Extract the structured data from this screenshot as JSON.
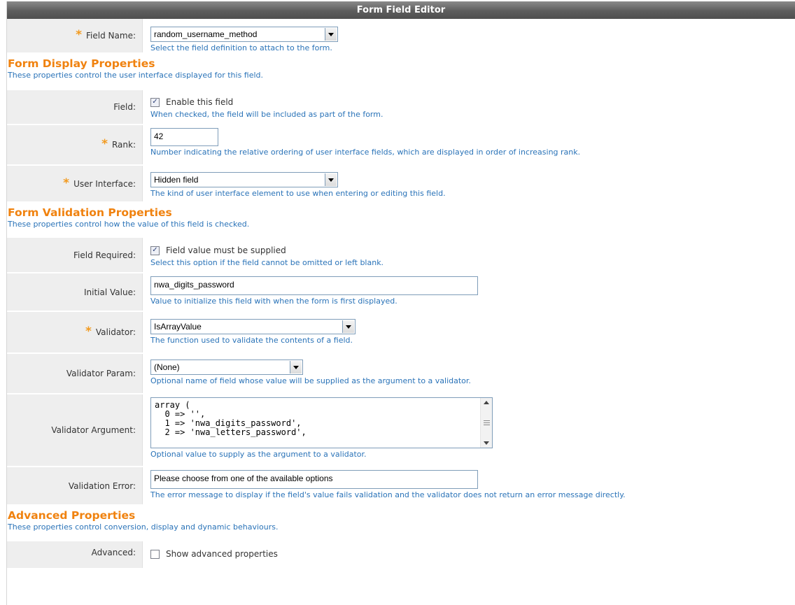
{
  "header": {
    "title": "Form Field Editor"
  },
  "field_name": {
    "label": "Field Name:",
    "required": "*",
    "value": "random_username_method",
    "help": "Select the field definition to attach to the form."
  },
  "display_section": {
    "title": "Form Display Properties",
    "desc": "These properties control the user interface displayed for this field."
  },
  "field_enable": {
    "label": "Field:",
    "checked": true,
    "text": "Enable this field",
    "help": "When checked, the field will be included as part of the form."
  },
  "rank": {
    "label": "Rank:",
    "required": "*",
    "value": "42",
    "help": "Number indicating the relative ordering of user interface fields, which are displayed in order of increasing rank."
  },
  "user_interface": {
    "label": "User Interface:",
    "required": "*",
    "value": "Hidden field",
    "help": "The kind of user interface element to use when entering or editing this field."
  },
  "validation_section": {
    "title": "Form Validation Properties",
    "desc": "These properties control how the value of this field is checked."
  },
  "field_required": {
    "label": "Field Required:",
    "checked": true,
    "text": "Field value must be supplied",
    "help": "Select this option if the field cannot be omitted or left blank."
  },
  "initial_value": {
    "label": "Initial Value:",
    "value": "nwa_digits_password",
    "help": "Value to initialize this field with when the form is first displayed."
  },
  "validator": {
    "label": "Validator:",
    "required": "*",
    "value": "IsArrayValue",
    "help": "The function used to validate the contents of a field."
  },
  "validator_param": {
    "label": "Validator Param:",
    "value": "(None)",
    "help": "Optional name of field whose value will be supplied as the argument to a validator."
  },
  "validator_argument": {
    "label": "Validator Argument:",
    "value": "array (\n  0 => '',\n  1 => 'nwa_digits_password',\n  2 => 'nwa_letters_password',",
    "help": "Optional value to supply as the argument to a validator."
  },
  "validation_error": {
    "label": "Validation Error:",
    "value": "Please choose from one of the available options",
    "help": "The error message to display if the field's value fails validation and the validator does not return an error message directly."
  },
  "advanced_section": {
    "title": "Advanced Properties",
    "desc": "These properties control conversion, display and dynamic behaviours."
  },
  "advanced": {
    "label": "Advanced:",
    "checked": false,
    "text": "Show advanced properties"
  },
  "colors": {
    "accent": "#f0820f",
    "help_text": "#2a73b8",
    "label_bg": "#eeeeee",
    "header_bg": "#5d5d5d"
  }
}
